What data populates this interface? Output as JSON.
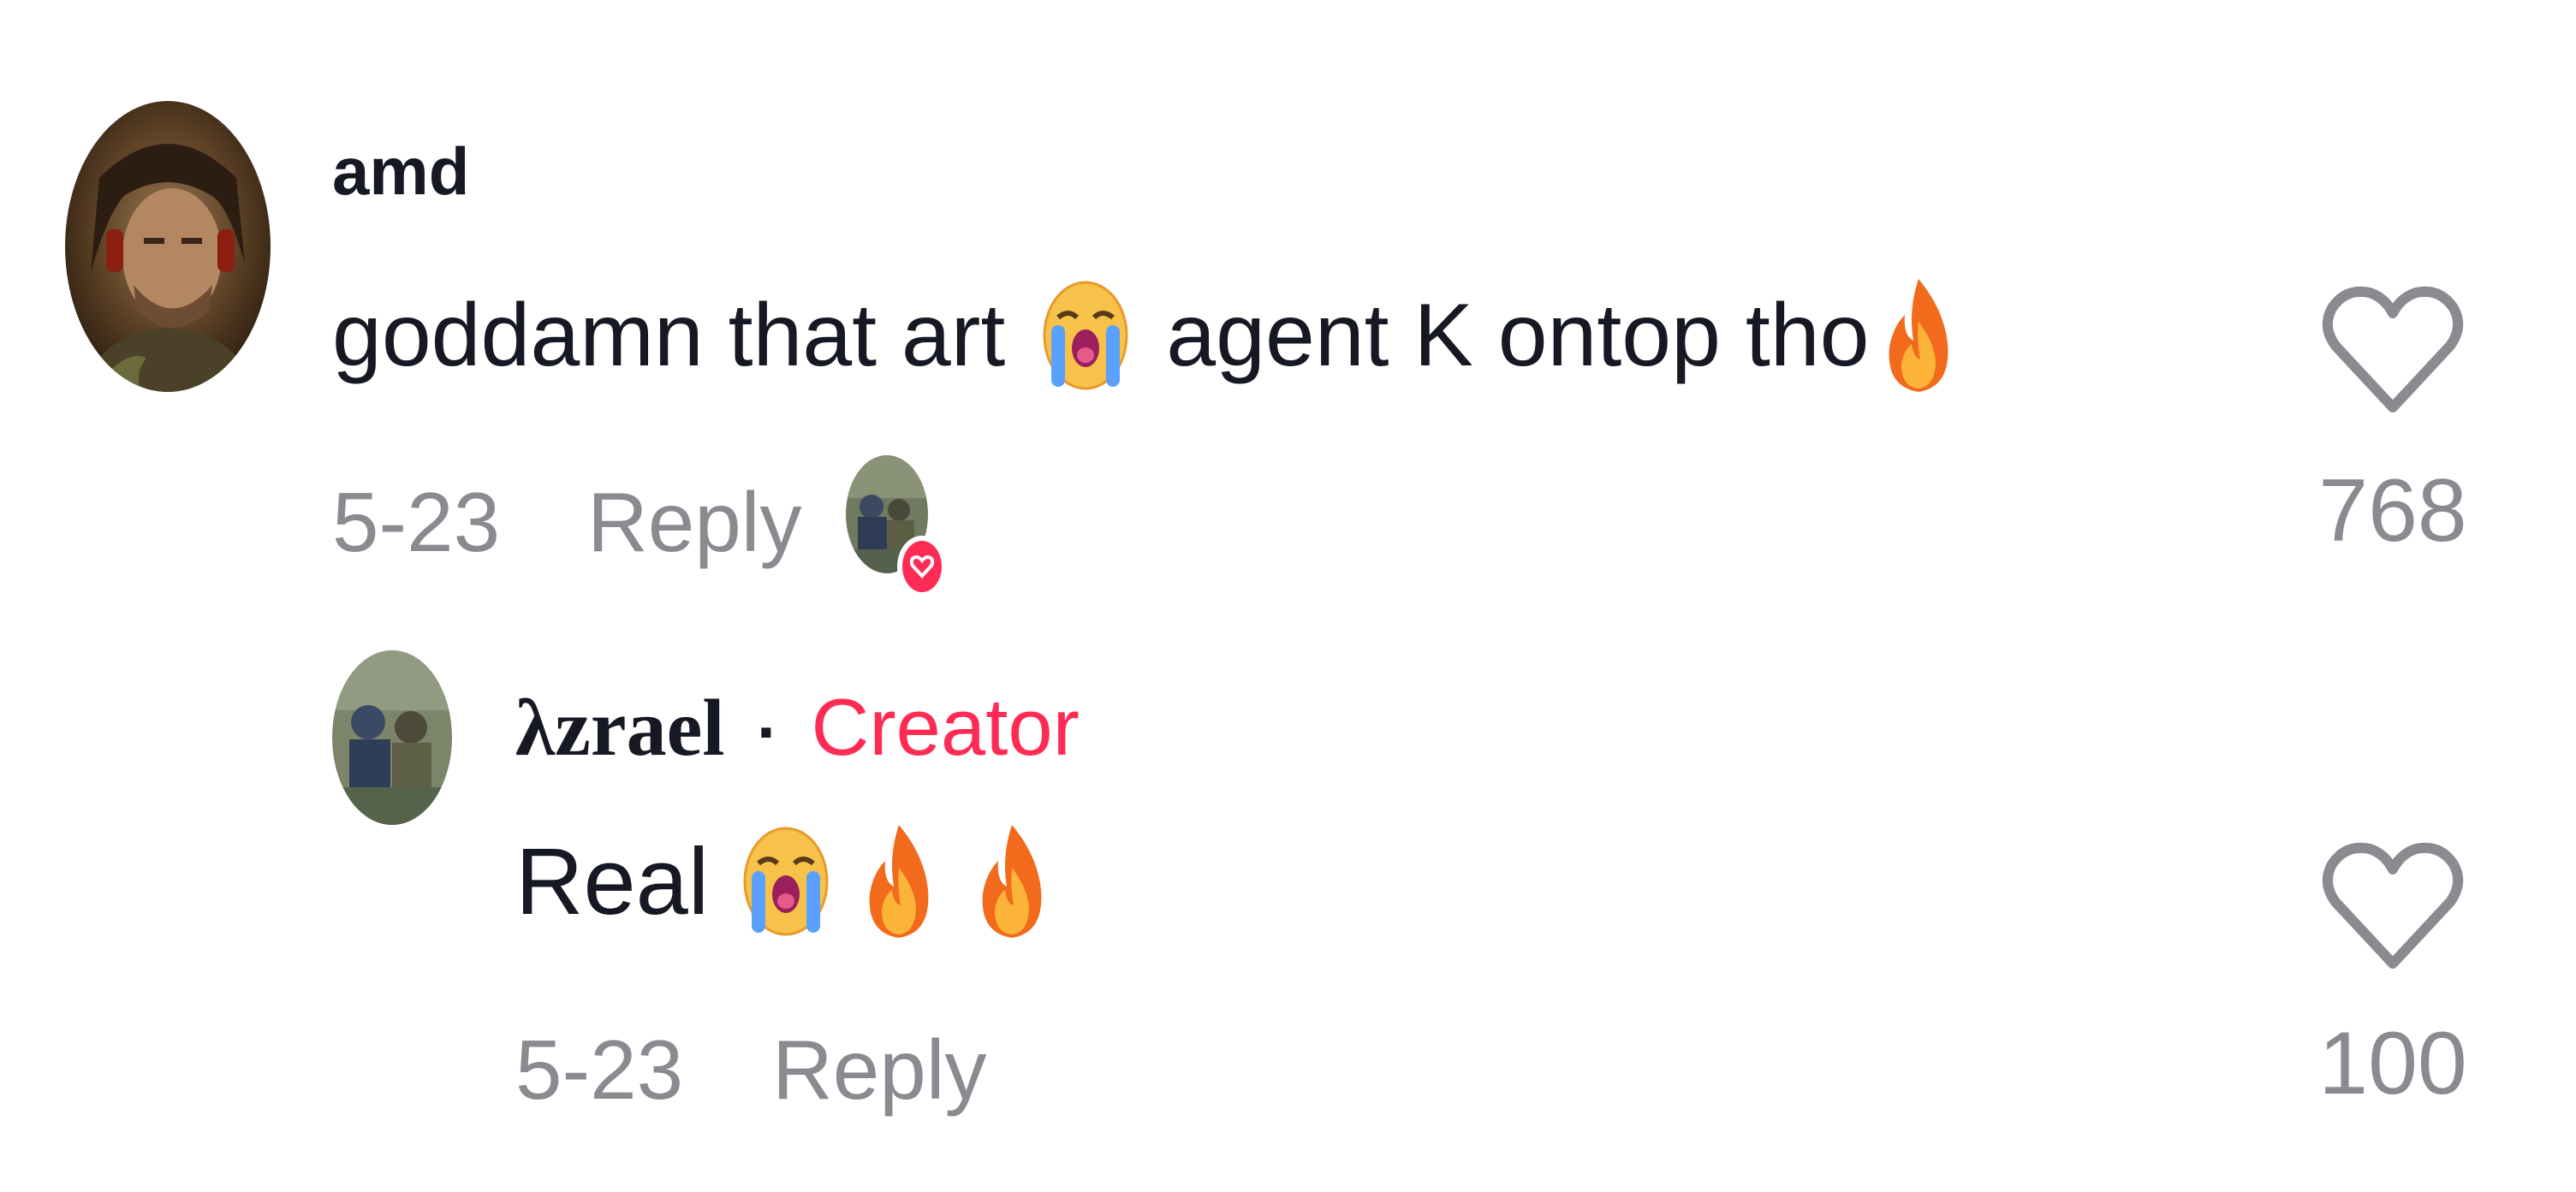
{
  "comments": [
    {
      "username": "amd",
      "text_parts": [
        "goddamn that art",
        "agent K ontop tho"
      ],
      "emojis": [
        "loudly-crying-face",
        "fire"
      ],
      "date": "5-23",
      "reply_label": "Reply",
      "like_count": "768",
      "liked_by_creator": true,
      "avatar_icon": "avatar-portrait"
    }
  ],
  "replies": [
    {
      "username": "λzrael",
      "separator": "·",
      "badge": "Creator",
      "text": "Real",
      "emojis": [
        "loudly-crying-face",
        "fire",
        "fire"
      ],
      "date": "5-23",
      "reply_label": "Reply",
      "like_count": "100",
      "avatar_icon": "avatar-group-photo"
    }
  ],
  "colors": {
    "text": "#161823",
    "meta": "#8a8b91",
    "creator": "#fe2c55",
    "heart_outline": "#8a8b91"
  }
}
